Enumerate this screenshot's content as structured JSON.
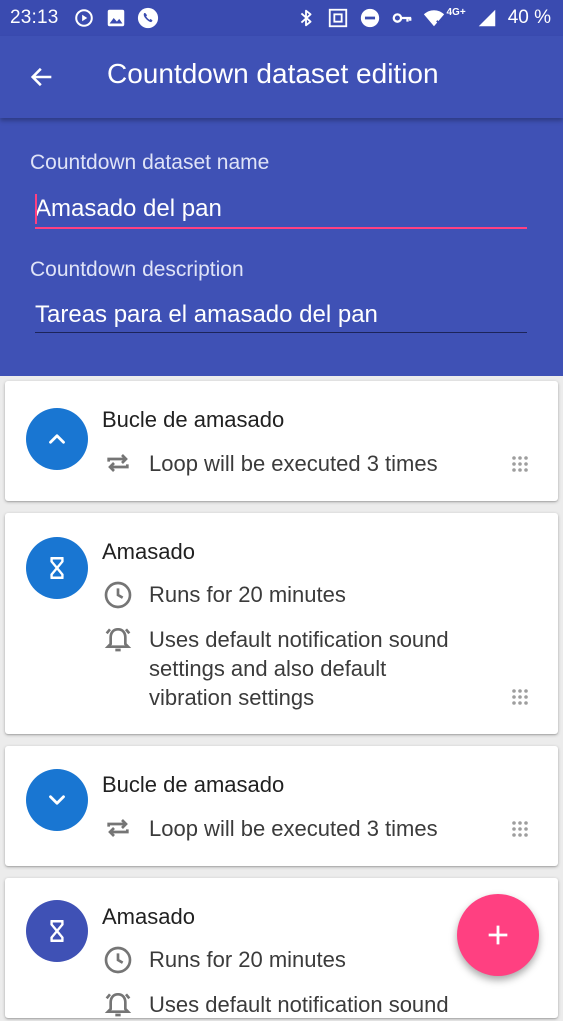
{
  "status_bar": {
    "time": "23:13",
    "network": "4G+",
    "battery": "40 %"
  },
  "app_bar": {
    "title": "Countdown dataset edition"
  },
  "form": {
    "name_label": "Countdown dataset name",
    "name_value": "Amasado del pan",
    "description_label": "Countdown description",
    "description_value": "Tareas para el amasado del pan"
  },
  "items": [
    {
      "title": "Bucle de amasado",
      "line1": "Loop will be executed 3 times"
    },
    {
      "title": "Amasado",
      "line1": "Runs for 20 minutes",
      "line2a": "Uses default notification sound",
      "line2b": "settings and also default",
      "line2c": "vibration settings"
    },
    {
      "title": "Bucle de amasado",
      "line1": "Loop will be executed 3 times"
    },
    {
      "title": "Amasado",
      "line1": "Runs for 20 minutes",
      "line2a": "Uses default notification sound"
    }
  ],
  "colors": {
    "primary": "#3f51b5",
    "status_bar": "#3a4bb0",
    "accent": "#ff4081",
    "loop_avatar": "#1976d2",
    "task_avatar": "#3f51b5"
  },
  "icons": [
    "back-arrow-icon",
    "loop-icon",
    "clock-icon",
    "alarm-icon",
    "hourglass-icon",
    "drag-handle-icon",
    "plus-icon"
  ]
}
